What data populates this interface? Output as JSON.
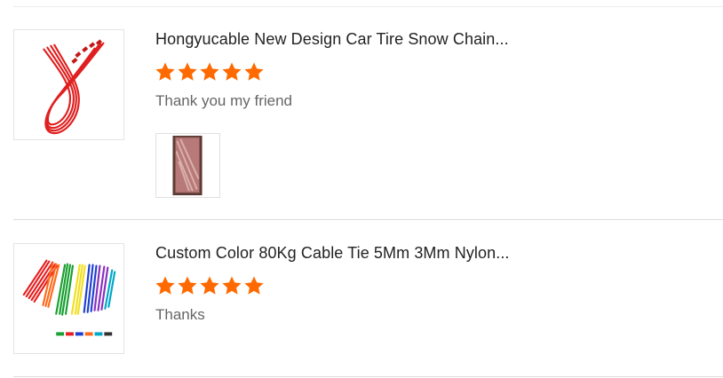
{
  "colors": {
    "star": "#ff6a00",
    "divider": "#dcdcdc",
    "comment_text": "#666666"
  },
  "reviews": [
    {
      "product_title": "Hongyucable New Design Car Tire Snow Chain...",
      "rating": 5,
      "comment": "Thank you my friend",
      "product_image_icon": "red-snow-chain-image",
      "buyer_photos": [
        "red-package-photo"
      ]
    },
    {
      "product_title": "Custom Color 80Kg Cable Tie 5Mm 3Mm Nylon...",
      "rating": 5,
      "comment": "Thanks",
      "product_image_icon": "colorful-cable-ties-image",
      "buyer_photos": []
    }
  ]
}
